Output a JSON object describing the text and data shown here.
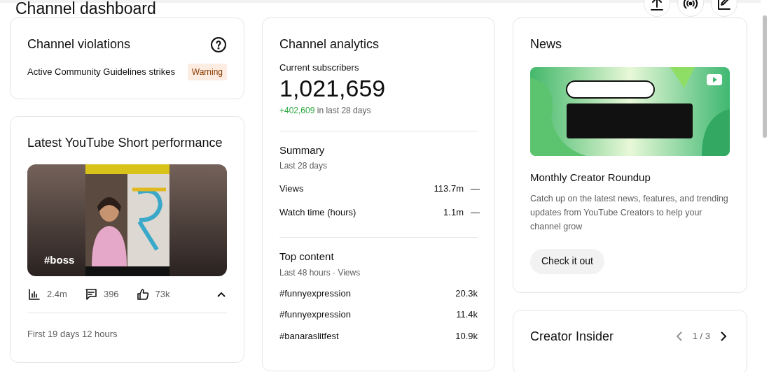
{
  "header": {
    "title": "Channel dashboard",
    "actions": [
      {
        "kind": "upload"
      },
      {
        "kind": "live"
      },
      {
        "kind": "edit"
      }
    ]
  },
  "violations": {
    "title": "Channel violations",
    "rows": [
      {
        "label": "Active Community Guidelines strikes",
        "badge": "Warning"
      }
    ]
  },
  "short": {
    "title": "Latest YouTube Short performance",
    "caption": "#boss",
    "stats": [
      {
        "kind": "views",
        "value": "2.4m"
      },
      {
        "kind": "comments",
        "value": "396"
      },
      {
        "kind": "likes",
        "value": "73k"
      }
    ],
    "expanded": true,
    "period": "First 19 days 12 hours"
  },
  "analytics": {
    "title": "Channel analytics",
    "subscribers_label": "Current subscribers",
    "subscribers": "1,021,659",
    "change": "+402,609",
    "change_suffix": "in last 28 days",
    "summary": {
      "title": "Summary",
      "subtitle": "Last 28 days",
      "rows": [
        {
          "label": "Views",
          "value": "113.7m",
          "trend": "—"
        },
        {
          "label": "Watch time (hours)",
          "value": "1.1m",
          "trend": "—"
        }
      ]
    },
    "top_content": {
      "title": "Top content",
      "subtitle": "Last 48 hours · Views",
      "rows": [
        {
          "label": "#funnyexpression",
          "value": "20.3k"
        },
        {
          "label": "#funnyexpression",
          "value": "11.4k"
        },
        {
          "label": "#banaraslitfest",
          "value": "10.9k"
        }
      ]
    }
  },
  "news": {
    "title": "News",
    "headline": "Monthly Creator Roundup",
    "description": "Catch up on the latest news, features, and trending updates from YouTube Creators to help your channel grow",
    "button": "Check it out"
  },
  "insider": {
    "title": "Creator Insider",
    "pager": {
      "label": "1 / 3",
      "prev": {
        "disabled": true
      },
      "next": {
        "disabled": false
      }
    }
  }
}
